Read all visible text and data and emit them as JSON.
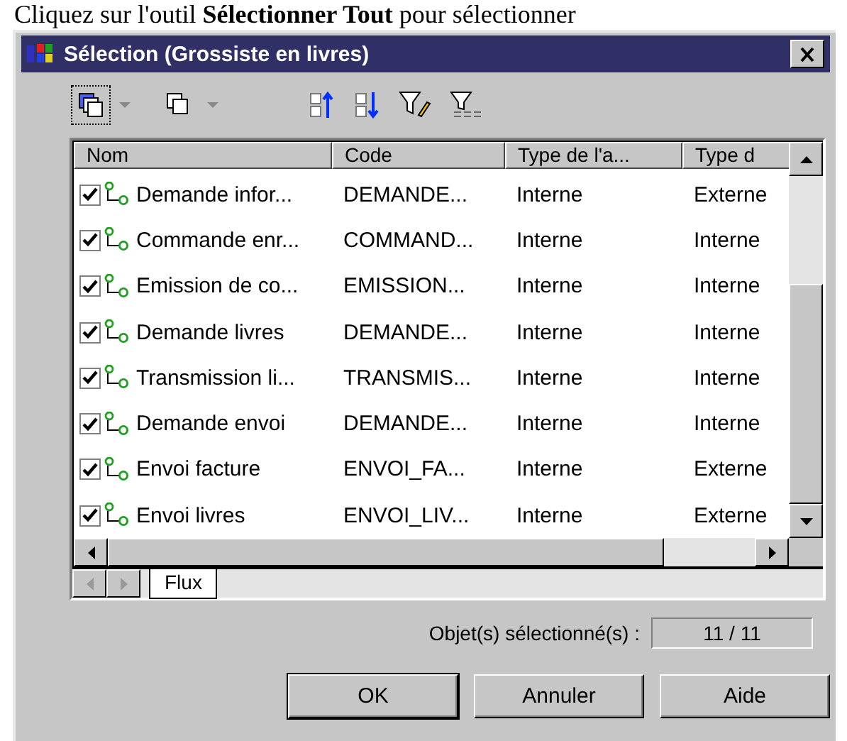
{
  "instruction": "Cliquez sur l'outil **Sélectionner Tout** pour sélectionner",
  "window": {
    "title": "Sélection (Grossiste en livres)"
  },
  "table": {
    "columns": [
      "Nom",
      "Code",
      "Type de l'a...",
      "Type d"
    ],
    "rows": [
      {
        "checked": true,
        "cells": [
          "Demande infor...",
          "DEMANDE...",
          "Interne",
          "Externe"
        ]
      },
      {
        "checked": true,
        "cells": [
          "Commande enr...",
          "COMMAND...",
          "Interne",
          "Interne"
        ]
      },
      {
        "checked": true,
        "cells": [
          "Emission de co...",
          "EMISSION...",
          "Interne",
          "Interne"
        ]
      },
      {
        "checked": true,
        "cells": [
          "Demande livres",
          "DEMANDE...",
          "Interne",
          "Interne"
        ]
      },
      {
        "checked": true,
        "cells": [
          "Transmission li...",
          "TRANSMIS...",
          "Interne",
          "Interne"
        ]
      },
      {
        "checked": true,
        "cells": [
          "Demande envoi",
          "DEMANDE...",
          "Interne",
          "Interne"
        ]
      },
      {
        "checked": true,
        "cells": [
          "Envoi facture",
          "ENVOI_FA...",
          "Interne",
          "Externe"
        ]
      },
      {
        "checked": true,
        "cells": [
          "Envoi livres",
          "ENVOI_LIV...",
          "Interne",
          "Externe"
        ]
      }
    ]
  },
  "tabs": [
    {
      "label": "Flux",
      "selected": true
    }
  ],
  "status": {
    "label": "Objet(s) sélectionné(s) :",
    "value": "11 / 11"
  },
  "buttons": [
    {
      "label": "OK",
      "default": true
    },
    {
      "label": "Annuler",
      "default": false
    },
    {
      "label": "Aide",
      "default": false
    }
  ]
}
